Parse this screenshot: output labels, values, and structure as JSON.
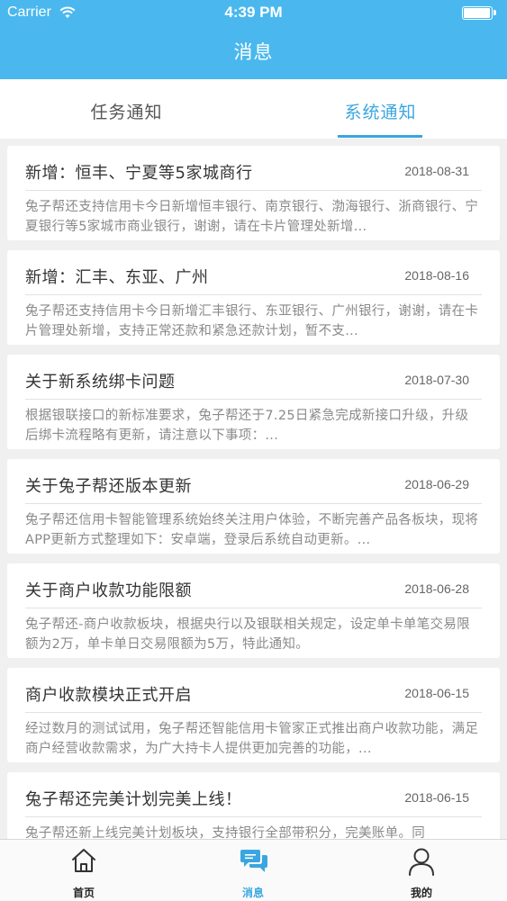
{
  "status_bar": {
    "carrier": "Carrier",
    "time": "4:39 PM"
  },
  "nav": {
    "title": "消息"
  },
  "tabs": [
    {
      "label": "任务通知",
      "active": false
    },
    {
      "label": "系统通知",
      "active": true
    }
  ],
  "messages": [
    {
      "title": "新增：恒丰、宁夏等5家城商行",
      "date": "2018-08-31",
      "body": "兔子帮还支持信用卡今日新增恒丰银行、南京银行、渤海银行、浙商银行、宁夏银行等5家城市商业银行，谢谢，请在卡片管理处新增..."
    },
    {
      "title": "新增：汇丰、东亚、广州",
      "date": "2018-08-16",
      "body": "兔子帮还支持信用卡今日新增汇丰银行、东亚银行、广州银行，谢谢，请在卡片管理处新增，支持正常还款和紧急还款计划，暂不支..."
    },
    {
      "title": "关于新系统绑卡问题",
      "date": "2018-07-30",
      "body": "根据银联接口的新标准要求，兔子帮还于7.25日紧急完成新接口升级，升级后绑卡流程略有更新，请注意以下事项：..."
    },
    {
      "title": "关于兔子帮还版本更新",
      "date": "2018-06-29",
      "body": "兔子帮还信用卡智能管理系统始终关注用户体验，不断完善产品各板块，现将APP更新方式整理如下：安卓端，登录后系统自动更新。..."
    },
    {
      "title": "关于商户收款功能限额",
      "date": "2018-06-28",
      "body": "兔子帮还-商户收款板块，根据央行以及银联相关规定，设定单卡单笔交易限额为2万，单卡单日交易限额为5万，特此通知。"
    },
    {
      "title": "商户收款模块正式开启",
      "date": "2018-06-15",
      "body": "经过数月的测试试用，兔子帮还智能信用卡管家正式推出商户收款功能，满足商户经营收款需求，为广大持卡人提供更加完善的功能，..."
    },
    {
      "title": "兔子帮还完美计划完美上线！",
      "date": "2018-06-15",
      "body": "兔子帮还新上线完美计划板块，支持银行全部带积分，完美账单。同"
    }
  ],
  "tabbar": [
    {
      "label": "首页",
      "icon": "home-icon",
      "active": false
    },
    {
      "label": "消息",
      "icon": "chat-icon",
      "active": true
    },
    {
      "label": "我的",
      "icon": "user-icon",
      "active": false
    }
  ],
  "colors": {
    "accent": "#4ab8ee",
    "active_tab": "#3aa6e0"
  }
}
